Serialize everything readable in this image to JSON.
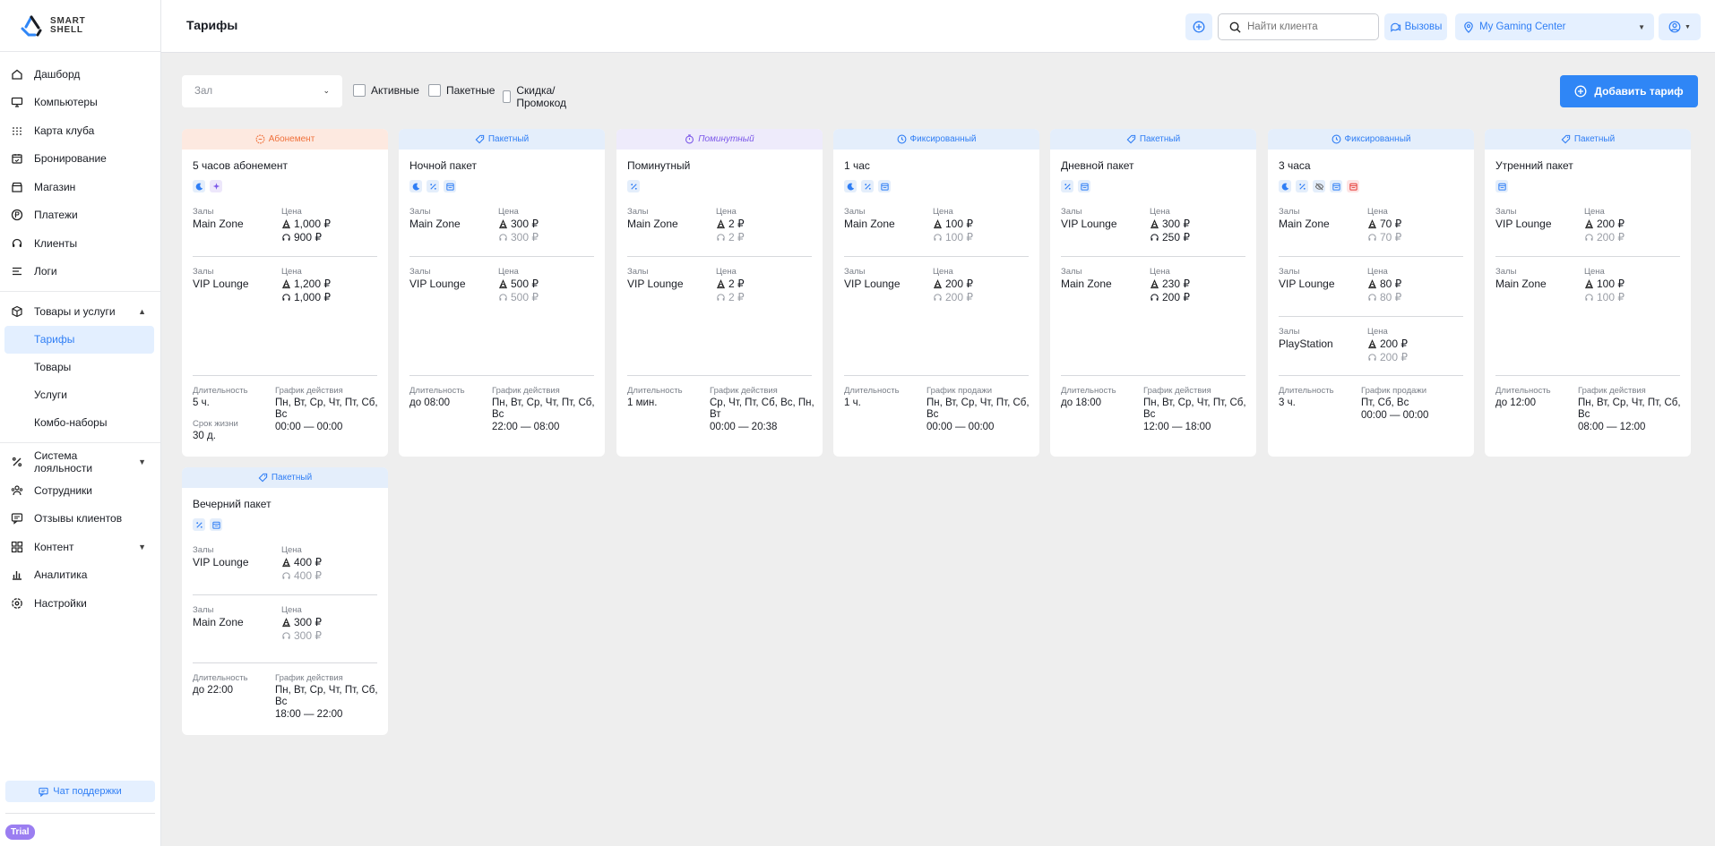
{
  "brand": {
    "line1": "SMART",
    "line2": "SHELL"
  },
  "nav": [
    {
      "label": "Дашборд",
      "icon": "home-icon"
    },
    {
      "label": "Компьютеры",
      "icon": "monitor-icon"
    },
    {
      "label": "Карта клуба",
      "icon": "grid-dots-icon"
    },
    {
      "label": "Бронирование",
      "icon": "calendar-check-icon"
    },
    {
      "label": "Магазин",
      "icon": "shop-icon"
    },
    {
      "label": "Платежи",
      "icon": "ruble-coin-icon"
    },
    {
      "label": "Клиенты",
      "icon": "headset-icon"
    },
    {
      "label": "Логи",
      "icon": "list-icon"
    }
  ],
  "nav_goods": {
    "label": "Товары и услуги",
    "sub": [
      "Тарифы",
      "Товары",
      "Услуги",
      "Комбо-наборы"
    ]
  },
  "nav_bottom": [
    {
      "label": "Система лояльности",
      "icon": "percent-icon",
      "chevron": true
    },
    {
      "label": "Сотрудники",
      "icon": "staff-icon",
      "chevron": false
    },
    {
      "label": "Отзывы клиентов",
      "icon": "message-icon",
      "chevron": false
    },
    {
      "label": "Контент",
      "icon": "layout-grid-icon",
      "chevron": true
    },
    {
      "label": "Аналитика",
      "icon": "bar-chart-icon",
      "chevron": false
    },
    {
      "label": "Настройки",
      "icon": "settings-icon",
      "chevron": false
    }
  ],
  "support_label": "Чат поддержки",
  "trial_label": "Trial",
  "header": {
    "title": "Тарифы",
    "search_placeholder": "Найти клиента",
    "calls_label": "Вызовы",
    "club": "My Gaming Center"
  },
  "filters": {
    "hall_placeholder": "Зал",
    "active": "Активные",
    "packages": "Пакетные",
    "discount": "Скидка/Промокод"
  },
  "add_button": "Добавить тариф",
  "labels": {
    "halls": "Залы",
    "price": "Цена",
    "duration": "Длительность",
    "lifetime": "Срок жизни"
  },
  "tariffs": [
    {
      "type": "Абонемент",
      "kind": "sub",
      "name": "5 часов абонемент",
      "icons": [
        "moon-icon",
        "sparkle-icon"
      ],
      "zones": [
        {
          "name": "Main Zone",
          "p1": "1,000 ₽",
          "p2": "900 ₽",
          "p2dark": true
        },
        {
          "name": "VIP Lounge",
          "p1": "1,200 ₽",
          "p2": "1,000 ₽",
          "p2dark": true
        }
      ],
      "duration": "5 ч.",
      "schedule_label": "График действия",
      "schedule_days": "Пн, Вт, Ср, Чт, Пт, Сб, Вс",
      "schedule_time": "00:00 — 00:00",
      "lifetime": "30 д."
    },
    {
      "type": "Пакетный",
      "kind": "pack",
      "name": "Ночной пакет",
      "icons": [
        "moon-icon",
        "percent-icon",
        "calendar-icon"
      ],
      "zones": [
        {
          "name": "Main Zone",
          "p1": "300 ₽",
          "p2": "300 ₽",
          "p2dark": false
        },
        {
          "name": "VIP Lounge",
          "p1": "500 ₽",
          "p2": "500 ₽",
          "p2dark": false
        }
      ],
      "duration": "до 08:00",
      "schedule_label": "График действия",
      "schedule_days": "Пн, Вт, Ср, Чт, Пт, Сб, Вс",
      "schedule_time": "22:00 — 08:00"
    },
    {
      "type": "Поминутный",
      "kind": "minute",
      "name": "Поминутный",
      "icons": [
        "percent-icon"
      ],
      "zones": [
        {
          "name": "Main Zone",
          "p1": "2 ₽",
          "p2": "2 ₽",
          "p2dark": false
        },
        {
          "name": "VIP Lounge",
          "p1": "2 ₽",
          "p2": "2 ₽",
          "p2dark": false
        }
      ],
      "duration": "1 мин.",
      "schedule_label": "График действия",
      "schedule_days": "Ср, Чт, Пт, Сб, Вс, Пн, Вт",
      "schedule_time": "00:00 — 20:38"
    },
    {
      "type": "Фиксированный",
      "kind": "fixed",
      "name": "1 час",
      "icons": [
        "moon-icon",
        "percent-icon",
        "calendar-icon"
      ],
      "zones": [
        {
          "name": "Main Zone",
          "p1": "100 ₽",
          "p2": "100 ₽",
          "p2dark": false
        },
        {
          "name": "VIP Lounge",
          "p1": "200 ₽",
          "p2": "200 ₽",
          "p2dark": false
        }
      ],
      "duration": "1 ч.",
      "schedule_label": "График продажи",
      "schedule_days": "Пн, Вт, Ср, Чт, Пт, Сб, Вс",
      "schedule_time": "00:00 — 00:00"
    },
    {
      "type": "Пакетный",
      "kind": "pack",
      "name": "Дневной пакет",
      "icons": [
        "percent-icon",
        "calendar-icon"
      ],
      "zones": [
        {
          "name": "VIP Lounge",
          "p1": "300 ₽",
          "p2": "250 ₽",
          "p2dark": true
        },
        {
          "name": "Main Zone",
          "p1": "230 ₽",
          "p2": "200 ₽",
          "p2dark": true
        }
      ],
      "duration": "до 18:00",
      "schedule_label": "График действия",
      "schedule_days": "Пн, Вт, Ср, Чт, Пт, Сб, Вс",
      "schedule_time": "12:00 — 18:00"
    },
    {
      "type": "Фиксированный",
      "kind": "fixed",
      "name": "3 часа",
      "icons": [
        "moon-icon",
        "percent-icon",
        "eye-off-icon",
        "calendar-icon",
        "calendar-red-icon"
      ],
      "zones": [
        {
          "name": "Main Zone",
          "p1": "70 ₽",
          "p2": "70 ₽",
          "p2dark": false
        },
        {
          "name": "VIP Lounge",
          "p1": "80 ₽",
          "p2": "80 ₽",
          "p2dark": false
        },
        {
          "name": "PlayStation",
          "p1": "200 ₽",
          "p2": "200 ₽",
          "p2dark": false
        }
      ],
      "duration": "3 ч.",
      "schedule_label": "График продажи",
      "schedule_days": "Пт, Сб, Вс",
      "schedule_time": "00:00 — 00:00"
    },
    {
      "type": "Пакетный",
      "kind": "pack",
      "name": "Утренний пакет",
      "icons": [
        "calendar-icon"
      ],
      "zones": [
        {
          "name": "VIP Lounge",
          "p1": "200 ₽",
          "p2": "200 ₽",
          "p2dark": false
        },
        {
          "name": "Main Zone",
          "p1": "100 ₽",
          "p2": "100 ₽",
          "p2dark": false
        }
      ],
      "duration": "до 12:00",
      "schedule_label": "График действия",
      "schedule_days": "Пн, Вт, Ср, Чт, Пт, Сб, Вс",
      "schedule_time": "08:00 — 12:00"
    },
    {
      "type": "Пакетный",
      "kind": "pack",
      "name": "Вечерний пакет",
      "icons": [
        "percent-icon",
        "calendar-icon"
      ],
      "zones": [
        {
          "name": "VIP Lounge",
          "p1": "400 ₽",
          "p2": "400 ₽",
          "p2dark": false
        },
        {
          "name": "Main Zone",
          "p1": "300 ₽",
          "p2": "300 ₽",
          "p2dark": false
        }
      ],
      "duration": "до 22:00",
      "schedule_label": "График действия",
      "schedule_days": "Пн, Вт, Ср, Чт, Пт, Сб, Вс",
      "schedule_time": "18:00 — 22:00"
    }
  ],
  "colors": {
    "accent": "#2f86f6",
    "subscription": "#f0703a",
    "per_minute": "#7b57e9",
    "page_bg": "#eeeeee"
  }
}
